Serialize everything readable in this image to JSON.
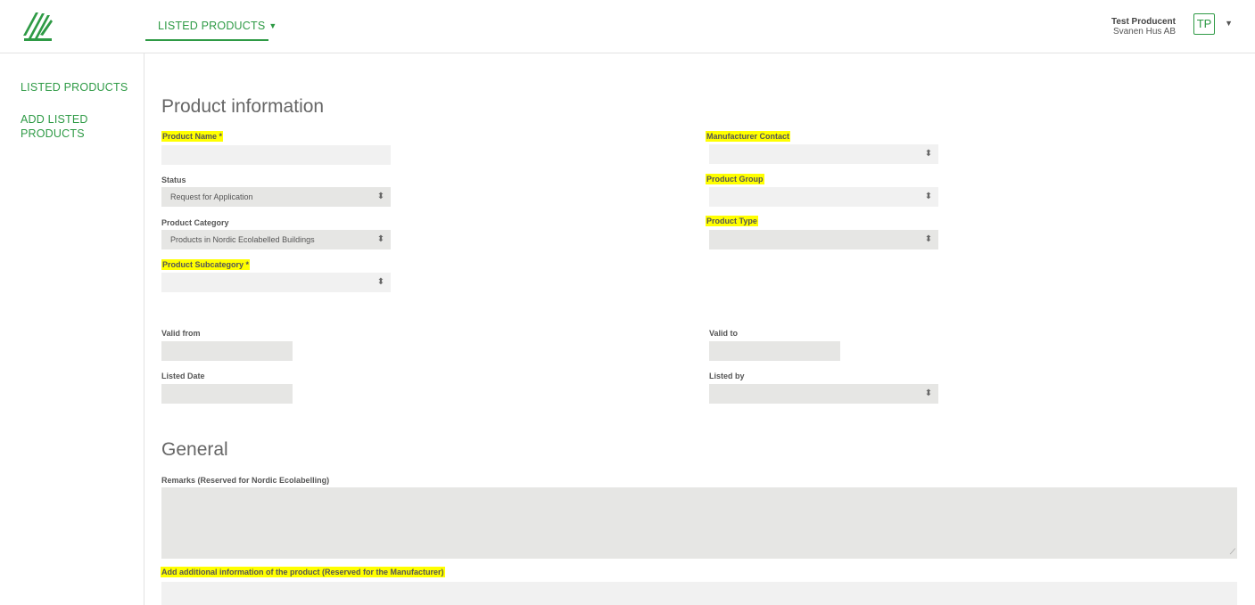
{
  "header": {
    "nav_tab": "LISTED PRODUCTS",
    "user_name": "Test Producent",
    "user_company": "Svanen Hus AB",
    "avatar_initials": "TP"
  },
  "sidebar": {
    "items": [
      {
        "label": "LISTED PRODUCTS"
      },
      {
        "label": "ADD LISTED PRODUCTS"
      }
    ]
  },
  "product_info": {
    "title": "Product information",
    "product_name_label": "Product Name *",
    "product_name_value": "",
    "status_label": "Status",
    "status_value": "Request for Application",
    "category_label": "Product Category",
    "category_value": "Products in Nordic Ecolabelled Buildings",
    "subcategory_label": "Product Subcategory *",
    "subcategory_value": "",
    "manufacturer_contact_label": "Manufacturer Contact",
    "product_group_label": "Product Group",
    "product_type_label": "Product Type",
    "valid_from_label": "Valid from",
    "valid_to_label": "Valid to",
    "listed_date_label": "Listed Date",
    "listed_by_label": "Listed by"
  },
  "general": {
    "title": "General",
    "remarks_label": "Remarks (Reserved for Nordic Ecolabelling)",
    "additional_info_label": "Add additional information of the product (Reserved for the Manufacturer)"
  },
  "colors": {
    "accent": "#2e9a45",
    "highlight": "#ffff00",
    "field_bg": "#f1f1f1",
    "field_disabled_bg": "#e6e6e4"
  }
}
